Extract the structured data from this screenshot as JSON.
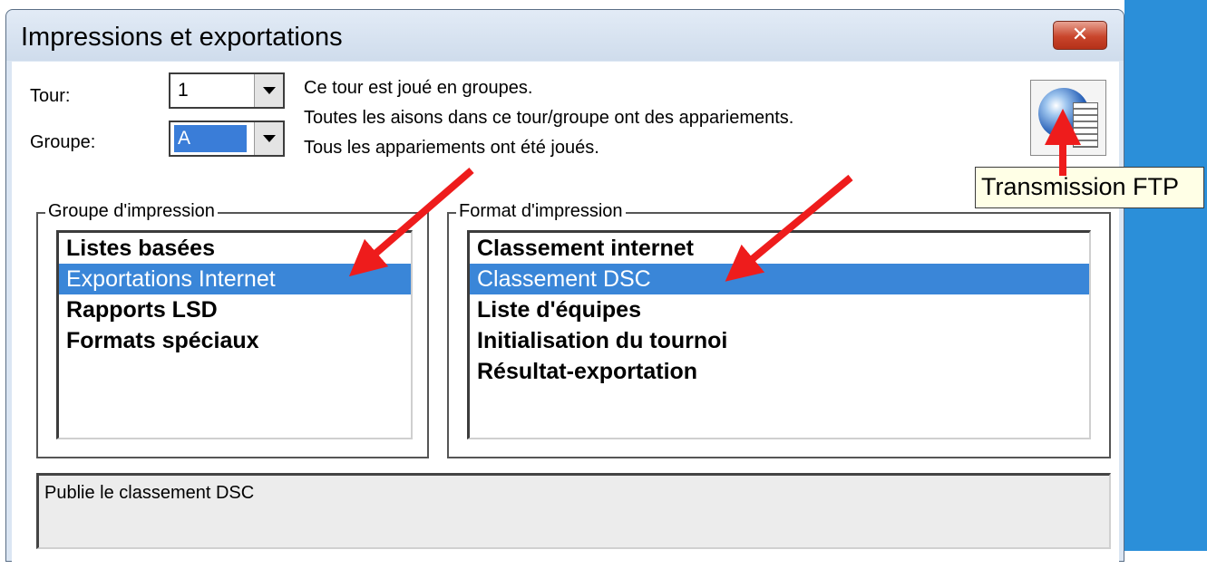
{
  "window": {
    "title": "Impressions et exportations",
    "close_label": "✕"
  },
  "form": {
    "tour_label": "Tour:",
    "tour_value": "1",
    "groupe_label": "Groupe:",
    "groupe_value": "A"
  },
  "info_lines": [
    "Ce tour est joué en groupes.",
    "Toutes les aisons dans ce tour/groupe ont des appariements.",
    "Tous les appariements ont été joués."
  ],
  "ftp": {
    "icon": "globe-ftp-icon",
    "tooltip": "Transmission FTP"
  },
  "print_group": {
    "title": "Groupe d'impression",
    "items": [
      "Listes basées",
      "Exportations Internet",
      "Rapports LSD",
      "Formats spéciaux"
    ],
    "selected": "Exportations Internet"
  },
  "print_format": {
    "title": "Format d'impression",
    "items": [
      "Classement internet",
      "Classement DSC",
      "Liste d'équipes",
      "Initialisation du tournoi",
      "Résultat-exportation"
    ],
    "selected": "Classement DSC"
  },
  "description": "Publie le classement DSC",
  "colors": {
    "selection": "#3a86d8",
    "annotation_arrow": "#ee1c1c",
    "desktop": "#2b8fd9"
  }
}
